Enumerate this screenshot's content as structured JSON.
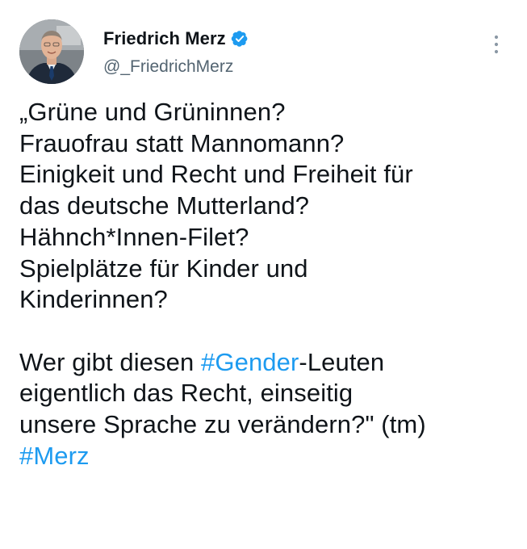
{
  "author": {
    "display_name": "Friedrich Merz",
    "handle": "@_FriedrichMerz",
    "verified": true,
    "avatar_icon": "profile-photo"
  },
  "tweet": {
    "lines": [
      "„Grüne und Grüninnen?",
      "Frauofrau statt Mannomann?",
      "Einigkeit und Recht und Freiheit für",
      "das deutsche Mutterland?",
      "Hähnch*Innen-Filet?",
      "Spielplätze für Kinder und",
      "Kinderinnen?",
      "",
      "Wer gibt diesen ",
      "#Gender",
      "-Leuten",
      "eigentlich das Recht, einseitig",
      "unsere Sprache zu verändern?\" (tm)",
      "#Merz"
    ]
  },
  "colors": {
    "text": "#0f1419",
    "secondary": "#536471",
    "link": "#1d9bf0",
    "verified": "#1d9bf0"
  },
  "icons": {
    "verified": "verified-badge-icon",
    "more": "more-options-icon"
  }
}
